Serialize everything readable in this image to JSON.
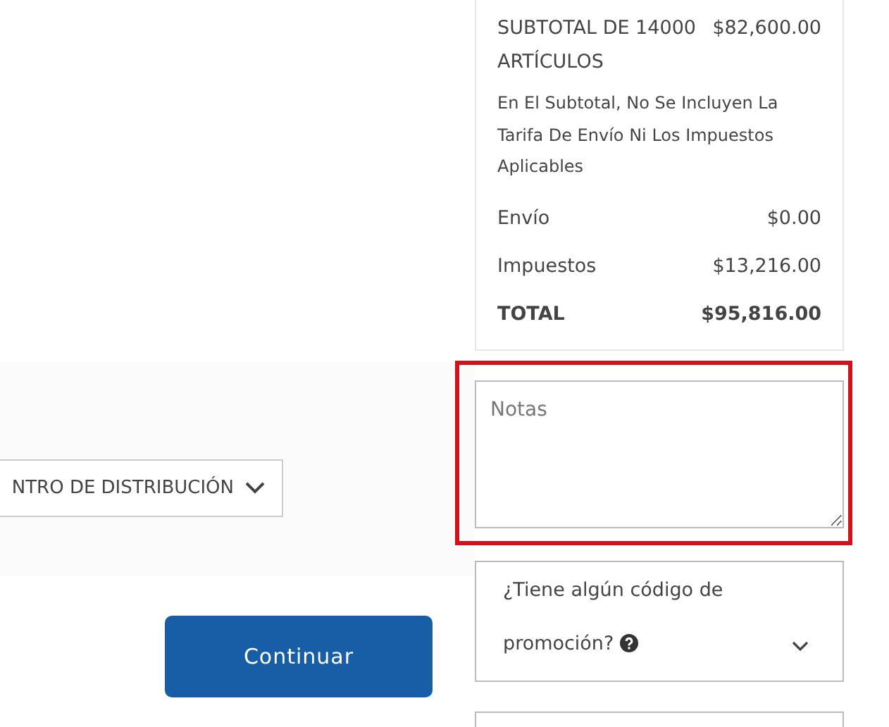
{
  "summary": {
    "subtotal_label": "SUBTOTAL DE 14000 ARTÍCULOS",
    "subtotal_value": "$82,600.00",
    "note": "En El Subtotal, No Se Incluyen La Tarifa De Envío Ni Los Impuestos Aplicables",
    "rows": [
      {
        "kind": "normal",
        "label": "Envío",
        "value": "$0.00"
      },
      {
        "kind": "normal",
        "label": "Impuestos",
        "value": "$13,216.00"
      },
      {
        "kind": "total",
        "label": "TOTAL",
        "value": "$95,816.00"
      }
    ]
  },
  "delivery_dropdown": {
    "value": "NTRO DE DISTRIBUCIÓN"
  },
  "notes": {
    "placeholder": "Notas",
    "highlighted": true
  },
  "promo": {
    "question_line_1": "¿Tiene algún código de",
    "question_line_2": "promoción?",
    "expanded": false
  },
  "continue_button": "Continuar"
}
